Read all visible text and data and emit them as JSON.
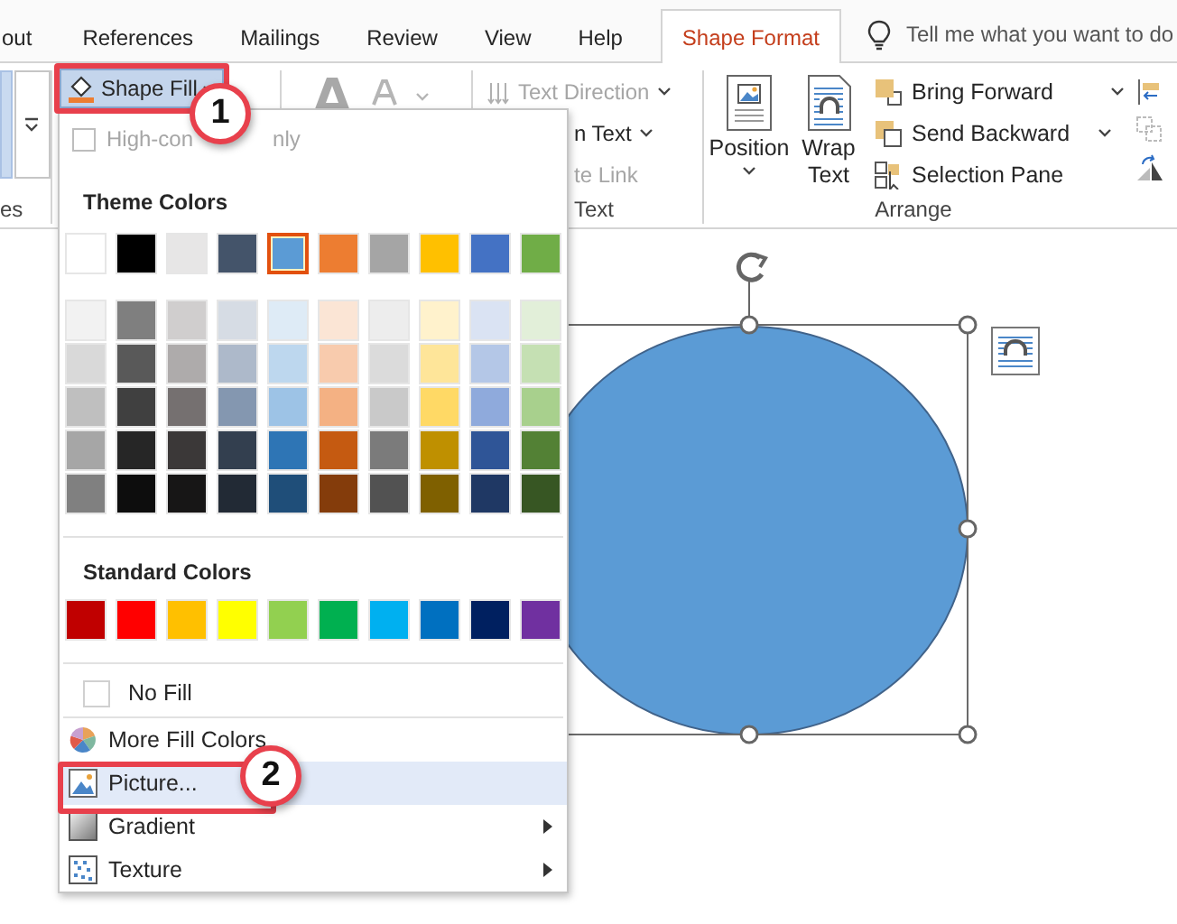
{
  "ribbon_tabs": [
    {
      "label": "out",
      "selected": false
    },
    {
      "label": "References",
      "selected": false
    },
    {
      "label": "Mailings",
      "selected": false
    },
    {
      "label": "Review",
      "selected": false
    },
    {
      "label": "View",
      "selected": false
    },
    {
      "label": "Help",
      "selected": false
    },
    {
      "label": "Shape Format",
      "selected": true
    }
  ],
  "tell_me": {
    "placeholder": "Tell me what you want to do"
  },
  "ribbon": {
    "shape_styles": {
      "label": "es"
    },
    "shape_fill": {
      "label": "Shape Fill",
      "selected": true
    },
    "text_group": {
      "label": "Text",
      "items": [
        {
          "label": "Text Direction",
          "disabled": true,
          "dropdown": true
        },
        {
          "label": "n Text",
          "disabled": false,
          "dropdown": true
        },
        {
          "label": "te Link",
          "disabled": true,
          "dropdown": false
        }
      ]
    },
    "arrange": {
      "label": "Arrange",
      "position": "Position",
      "wrap_text": "Wrap Text",
      "items": [
        {
          "label": "Bring Forward",
          "kind": "forward",
          "dropdown": true
        },
        {
          "label": "Send Backward",
          "kind": "backward",
          "dropdown": true
        },
        {
          "label": "Selection Pane",
          "kind": "pane",
          "dropdown": false
        }
      ]
    }
  },
  "menu": {
    "high_contrast": {
      "label": "High-con",
      "label_end": "nly",
      "checked": false,
      "disabled": true
    },
    "theme_title": "Theme Colors",
    "theme_colors": [
      {
        "color": "#ffffff",
        "selected": false
      },
      {
        "color": "#000000",
        "selected": false
      },
      {
        "color": "#e7e6e6",
        "selected": false
      },
      {
        "color": "#44546a",
        "selected": false
      },
      {
        "color": "#5b9bd5",
        "selected": true
      },
      {
        "color": "#ed7d31",
        "selected": false
      },
      {
        "color": "#a5a5a5",
        "selected": false
      },
      {
        "color": "#ffc000",
        "selected": false
      },
      {
        "color": "#4472c4",
        "selected": false
      },
      {
        "color": "#70ad47",
        "selected": false
      }
    ],
    "theme_shades": [
      [
        {
          "color": "#f2f2f2",
          "selected": false
        },
        {
          "color": "#7f7f7f",
          "selected": false
        },
        {
          "color": "#d0cece",
          "selected": false
        },
        {
          "color": "#d6dce4",
          "selected": false
        },
        {
          "color": "#deebf6",
          "selected": false
        },
        {
          "color": "#fbe5d5",
          "selected": false
        },
        {
          "color": "#ededed",
          "selected": false
        },
        {
          "color": "#fff2cc",
          "selected": false
        },
        {
          "color": "#dae3f3",
          "selected": false
        },
        {
          "color": "#e2efd9",
          "selected": false
        }
      ],
      [
        {
          "color": "#d9d9d9",
          "selected": false
        },
        {
          "color": "#595959",
          "selected": false
        },
        {
          "color": "#aeabab",
          "selected": false
        },
        {
          "color": "#adb9ca",
          "selected": false
        },
        {
          "color": "#bdd7ee",
          "selected": false
        },
        {
          "color": "#f8cbad",
          "selected": false
        },
        {
          "color": "#dbdbdb",
          "selected": false
        },
        {
          "color": "#fee599",
          "selected": false
        },
        {
          "color": "#b4c7e7",
          "selected": false
        },
        {
          "color": "#c5e0b3",
          "selected": false
        }
      ],
      [
        {
          "color": "#bfbfbf",
          "selected": false
        },
        {
          "color": "#404040",
          "selected": false
        },
        {
          "color": "#757070",
          "selected": false
        },
        {
          "color": "#8497b0",
          "selected": false
        },
        {
          "color": "#9dc3e6",
          "selected": false
        },
        {
          "color": "#f4b183",
          "selected": false
        },
        {
          "color": "#c9c9c9",
          "selected": false
        },
        {
          "color": "#ffd965",
          "selected": false
        },
        {
          "color": "#8faadc",
          "selected": false
        },
        {
          "color": "#a8d08d",
          "selected": false
        }
      ],
      [
        {
          "color": "#a6a6a6",
          "selected": false
        },
        {
          "color": "#262626",
          "selected": false
        },
        {
          "color": "#3b3838",
          "selected": false
        },
        {
          "color": "#333f4f",
          "selected": false
        },
        {
          "color": "#2e75b5",
          "selected": false
        },
        {
          "color": "#c55a11",
          "selected": false
        },
        {
          "color": "#7b7b7b",
          "selected": false
        },
        {
          "color": "#bf9000",
          "selected": false
        },
        {
          "color": "#2f5597",
          "selected": false
        },
        {
          "color": "#538135",
          "selected": false
        }
      ],
      [
        {
          "color": "#808080",
          "selected": false
        },
        {
          "color": "#0d0d0d",
          "selected": false
        },
        {
          "color": "#171616",
          "selected": false
        },
        {
          "color": "#222a35",
          "selected": false
        },
        {
          "color": "#1f4e79",
          "selected": false
        },
        {
          "color": "#843c0b",
          "selected": false
        },
        {
          "color": "#525252",
          "selected": false
        },
        {
          "color": "#7f6000",
          "selected": false
        },
        {
          "color": "#1f3864",
          "selected": false
        },
        {
          "color": "#375623",
          "selected": false
        }
      ]
    ],
    "standard_title": "Standard Colors",
    "standard_colors": [
      {
        "color": "#c00000",
        "selected": false
      },
      {
        "color": "#ff0000",
        "selected": false
      },
      {
        "color": "#ffc000",
        "selected": false
      },
      {
        "color": "#ffff00",
        "selected": false
      },
      {
        "color": "#92d050",
        "selected": false
      },
      {
        "color": "#00b050",
        "selected": false
      },
      {
        "color": "#00b0f0",
        "selected": false
      },
      {
        "color": "#0070c0",
        "selected": false
      },
      {
        "color": "#002060",
        "selected": false
      },
      {
        "color": "#7030a0",
        "selected": false
      }
    ],
    "no_fill": {
      "label": "No Fill",
      "checked": false
    },
    "items": [
      {
        "kind": "more",
        "label": "More Fill Colors",
        "selected": false,
        "submenu": false
      },
      {
        "kind": "picture",
        "label": "Picture...",
        "selected": true,
        "submenu": false
      },
      {
        "kind": "gradient",
        "label": "Gradient",
        "selected": false,
        "submenu": true
      },
      {
        "kind": "texture",
        "label": "Texture",
        "selected": false,
        "submenu": true
      }
    ]
  },
  "callouts": [
    {
      "label": "1"
    },
    {
      "label": "2"
    }
  ]
}
